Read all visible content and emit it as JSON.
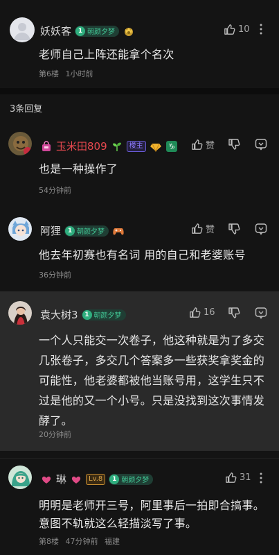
{
  "main_post": {
    "user": "妖妖客",
    "level": "1",
    "badge_title": "朝颜夕梦",
    "likes": "10",
    "text": "老师自己上阵还能拿个名次",
    "floor": "第6楼",
    "time": "1小时前"
  },
  "replies_header": "3条回复",
  "replies": [
    {
      "user": "玉米田809",
      "owner_badge": "楼主",
      "like_label": "赞",
      "text": "也是一种操作了",
      "time": "54分钟前"
    },
    {
      "user": "阿狸",
      "level": "1",
      "badge_title": "朝颜夕梦",
      "like_label": "赞",
      "text": "他去年初赛也有名词 用的自己和老婆账号",
      "time": "36分钟前"
    },
    {
      "user": "袁大树3",
      "level": "1",
      "badge_title": "朝颜夕梦",
      "likes": "16",
      "text": "一个人只能交一次卷子，他这种就是为了多交几张卷子，多交几个答案多一些获奖拿奖金的可能性，他老婆都被他当账号用，这学生只不过是他的又一个小号。只是没找到这次事情发酵了。",
      "time": "20分钟前"
    }
  ],
  "next_post": {
    "user": "琳",
    "lv_badge": "Lv.8",
    "level": "1",
    "badge_title": "朝颜夕梦",
    "likes": "31",
    "text": "明明是老师开三号，阿里事后一拍即合搞事。意图不轨就这么轻描淡写了事。",
    "floor": "第8楼",
    "time": "47分钟前",
    "location": "福建"
  }
}
